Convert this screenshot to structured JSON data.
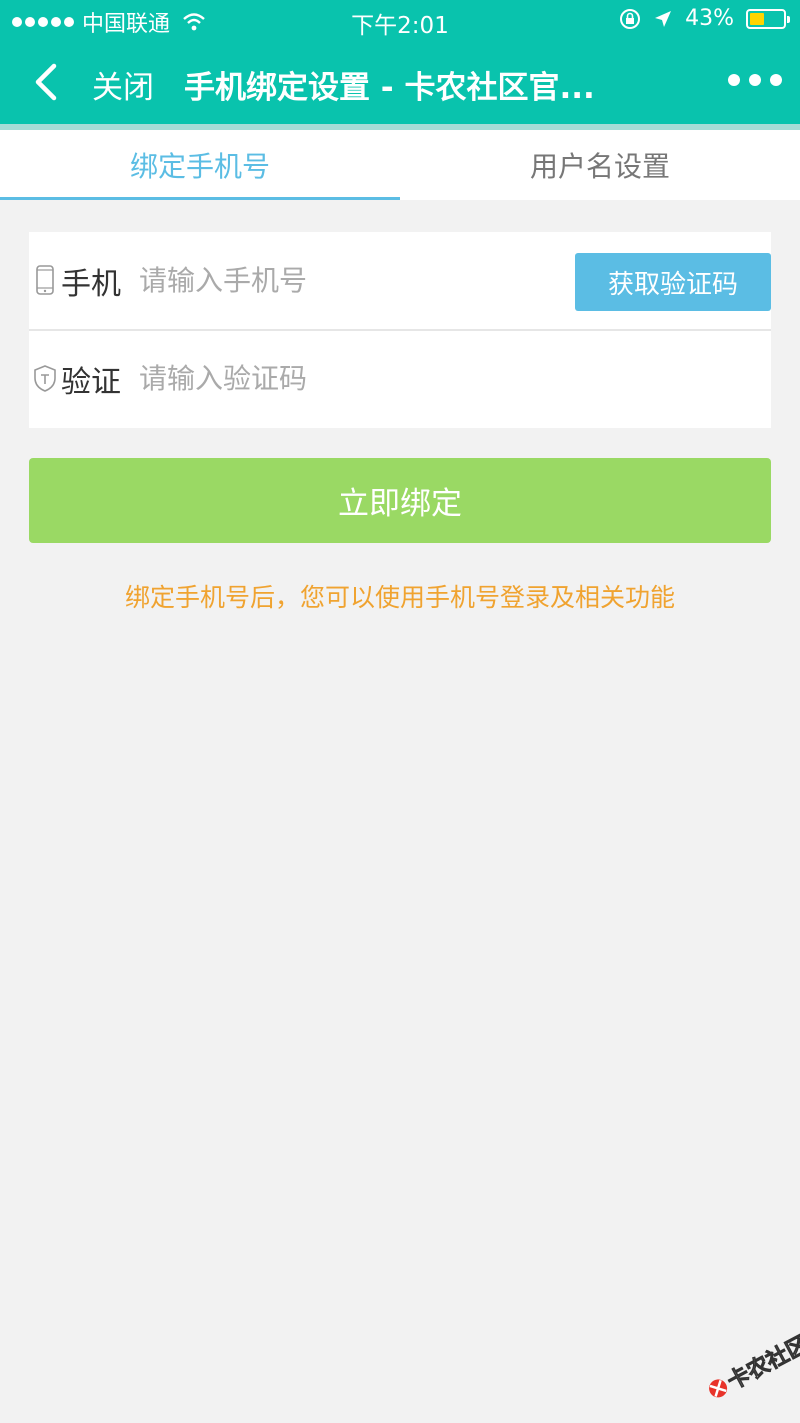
{
  "status_bar": {
    "carrier": "中国联通",
    "time": "下午2:01",
    "battery_percent_text": "43%",
    "battery_level": 0.43,
    "colors": {
      "background": "#09c3ad",
      "battery_fill": "#ffd400"
    }
  },
  "nav": {
    "close_label": "关闭",
    "title": "手机绑定设置 - 卡农社区官...",
    "back_icon": "chevron-left-icon",
    "more_icon": "more-dots-icon"
  },
  "tabs": [
    {
      "label": "绑定手机号",
      "active": true
    },
    {
      "label": "用户名设置",
      "active": false
    }
  ],
  "form": {
    "phone": {
      "label": "手机",
      "placeholder": "请输入手机号",
      "value": "",
      "icon": "phone-icon"
    },
    "code": {
      "label": "验证",
      "placeholder": "请输入验证码",
      "value": "",
      "icon": "shield-icon"
    },
    "get_code_label": "获取验证码"
  },
  "submit_label": "立即绑定",
  "hint": "绑定手机号后，您可以使用手机号登录及相关功能",
  "watermark": {
    "text": "卡农社区",
    "icon": "kanong-logo-icon"
  },
  "colors": {
    "accent": "#09c3ad",
    "tab_active": "#5bbde4",
    "button_blue": "#5bbde4",
    "submit_green": "#9ad964",
    "hint_orange": "#f0a330",
    "page_bg": "#f2f2f2"
  }
}
